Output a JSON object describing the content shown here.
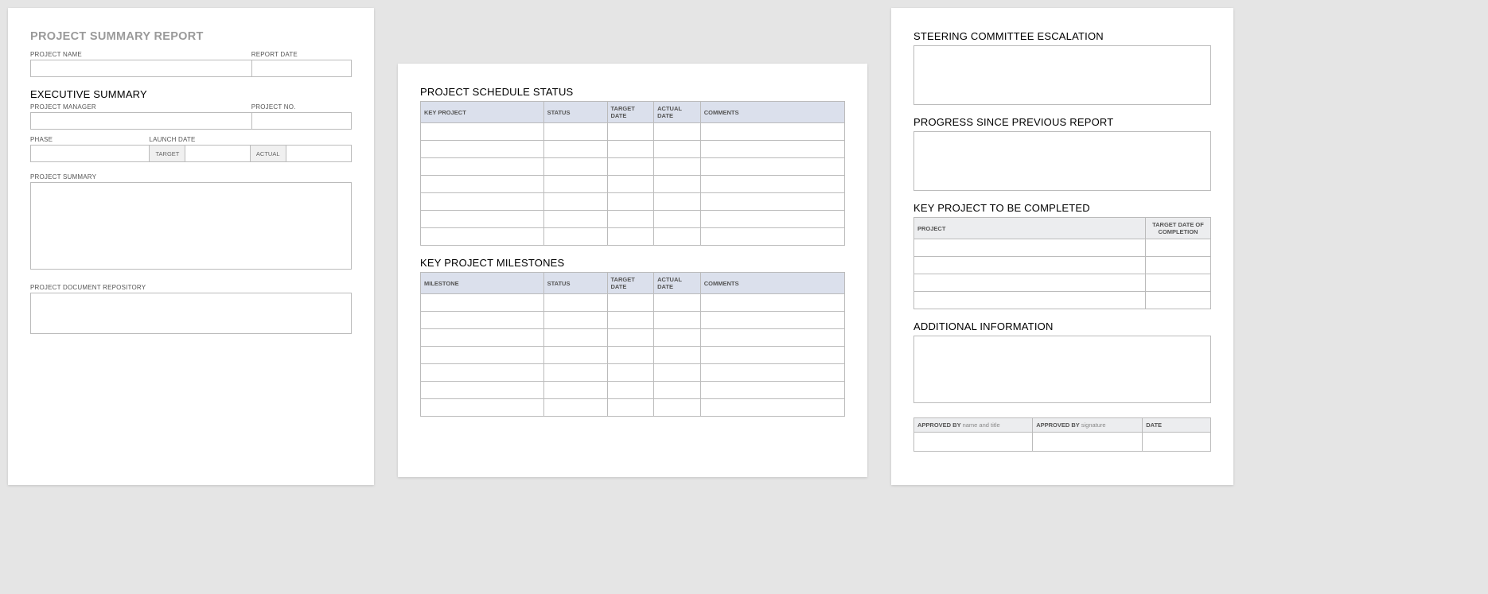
{
  "page1": {
    "title": "PROJECT SUMMARY REPORT",
    "fields": {
      "project_name": "PROJECT NAME",
      "report_date": "REPORT DATE",
      "exec_summary": "EXECUTIVE SUMMARY",
      "project_manager": "PROJECT MANAGER",
      "project_no": "PROJECT NO.",
      "phase": "PHASE",
      "launch_date": "LAUNCH DATE",
      "target": "TARGET",
      "actual": "ACTUAL",
      "project_summary": "PROJECT SUMMARY",
      "project_docs": "PROJECT DOCUMENT REPOSITORY"
    }
  },
  "page2": {
    "schedule_title": "PROJECT SCHEDULE STATUS",
    "schedule_headers": {
      "key_project": "KEY PROJECT",
      "status": "STATUS",
      "target_date": "TARGET DATE",
      "actual_date": "ACTUAL DATE",
      "comments": "COMMENTS"
    },
    "milestones_title": "KEY PROJECT MILESTONES",
    "milestone_headers": {
      "milestone": "MILESTONE",
      "status": "STATUS",
      "target_date": "TARGET DATE",
      "actual_date": "ACTUAL DATE",
      "comments": "COMMENTS"
    }
  },
  "page3": {
    "steering_title": "STEERING COMMITTEE ESCALATION",
    "progress_title": "PROGRESS SINCE PREVIOUS REPORT",
    "key_project_title": "KEY PROJECT TO BE COMPLETED",
    "kp_headers": {
      "project": "PROJECT",
      "target_completion": "TARGET DATE OF COMPLETION"
    },
    "additional_title": "ADDITIONAL INFORMATION",
    "approval": {
      "approved_by": "APPROVED BY",
      "name_title": "name and title",
      "signature": "signature",
      "date": "DATE"
    }
  }
}
